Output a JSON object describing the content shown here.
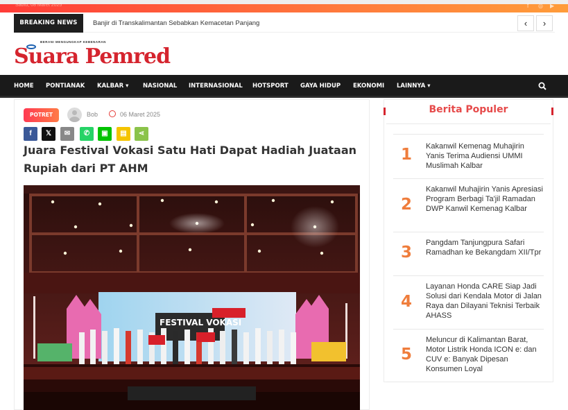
{
  "topbar": {
    "date": "Sabtu, 08 Maret 2025"
  },
  "breaking": {
    "label": "BREAKING NEWS",
    "headline": "Banjir di Transkalimantan Sebabkan Kemacetan Panjang",
    "prev": "‹",
    "next": "›"
  },
  "logo": {
    "tagline": "BERANI MENGUNGKAP KEBENARAN",
    "name": "Suara Pemred"
  },
  "nav": {
    "items": [
      "HOME",
      "PONTIANAK",
      "KALBAR",
      "NASIONAL",
      "INTERNASIONAL",
      "HOTSPORT",
      "GAYA HIDUP",
      "EKONOMI",
      "LAINNYA"
    ],
    "caret": "▾"
  },
  "article": {
    "category": "POTRET",
    "author": "Bob",
    "date": "06 Maret 2025",
    "share": [
      {
        "icon": "facebook-icon",
        "glyph": "f",
        "color": "#3b5998"
      },
      {
        "icon": "x-icon",
        "glyph": "𝕏",
        "color": "#111111"
      },
      {
        "icon": "email-icon",
        "glyph": "✉",
        "color": "#888888"
      },
      {
        "icon": "whatsapp-icon",
        "glyph": "✆",
        "color": "#25d366"
      },
      {
        "icon": "line-icon",
        "glyph": "▣",
        "color": "#00c300"
      },
      {
        "icon": "sms-icon",
        "glyph": "▤",
        "color": "#f5c400"
      },
      {
        "icon": "share-icon",
        "glyph": "⋖",
        "color": "#8bc34a"
      }
    ],
    "title": "Juara Festival Vokasi Satu Hati Dapat Hadiah Juataan Rupiah dari PT AHM",
    "photo_banner": "FESTIVAL VOKASI"
  },
  "sidebar": {
    "title": "Berita Populer",
    "items": [
      {
        "num": "1",
        "title": "Kakanwil Kemenag Muhajirin Yanis Terima Audiensi UMMI Muslimah Kalbar"
      },
      {
        "num": "2",
        "title": "Kakanwil Muhajirin Yanis Apresiasi Program Berbagi Ta'jil Ramadan DWP Kanwil Kemenag Kalbar"
      },
      {
        "num": "3",
        "title": "Pangdam Tanjungpura Safari Ramadhan ke Bekangdam XII/Tpr"
      },
      {
        "num": "4",
        "title": "Layanan Honda CARE Siap Jadi Solusi dari Kendala Motor di Jalan Raya dan Dilayani Teknisi Terbaik AHASS"
      },
      {
        "num": "5",
        "title": "Meluncur di Kalimantan Barat, Motor Listrik Honda ICON e: dan CUV e: Banyak Dipesan Konsumen Loyal"
      }
    ]
  },
  "colors": {
    "accent": "#d5242e",
    "number": "#ef7d3c",
    "nav": "#1a1a1a"
  }
}
